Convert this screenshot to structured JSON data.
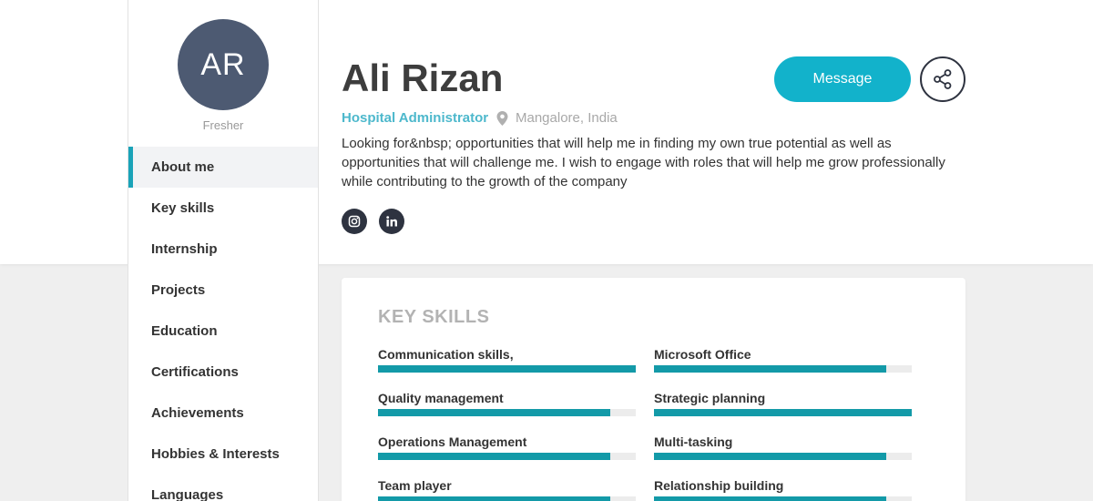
{
  "profile": {
    "initials": "AR",
    "status": "Fresher",
    "name": "Ali Rizan",
    "role": "Hospital Administrator",
    "location": "Mangalore, India",
    "bio": "Looking for&nbsp; opportunities that will help me in finding my own true potential as well as opportunities that will challenge me. I wish to engage with roles that will help me grow professionally while contributing to the growth of the company"
  },
  "actions": {
    "message_label": "Message"
  },
  "nav": [
    {
      "label": "About me",
      "active": true
    },
    {
      "label": "Key skills"
    },
    {
      "label": "Internship"
    },
    {
      "label": "Projects"
    },
    {
      "label": "Education"
    },
    {
      "label": "Certifications"
    },
    {
      "label": "Achievements"
    },
    {
      "label": "Hobbies & Interests"
    },
    {
      "label": "Languages"
    }
  ],
  "skills_section": {
    "title": "KEY SKILLS",
    "skills": [
      {
        "label": "Communication skills,",
        "level": 1.0
      },
      {
        "label": "Microsoft Office",
        "level": 0.9
      },
      {
        "label": "Quality management",
        "level": 0.9
      },
      {
        "label": "Strategic planning",
        "level": 1.0
      },
      {
        "label": "Operations Management",
        "level": 0.9
      },
      {
        "label": "Multi-tasking",
        "level": 0.9
      },
      {
        "label": "Team player",
        "level": 0.9
      },
      {
        "label": "Relationship building",
        "level": 0.9
      }
    ]
  },
  "colors": {
    "accent": "#12b2cb",
    "bar": "#139aa8",
    "avatar": "#4d5a72"
  },
  "icons": [
    "map-pin-icon",
    "instagram-icon",
    "linkedin-icon",
    "share-icon"
  ]
}
